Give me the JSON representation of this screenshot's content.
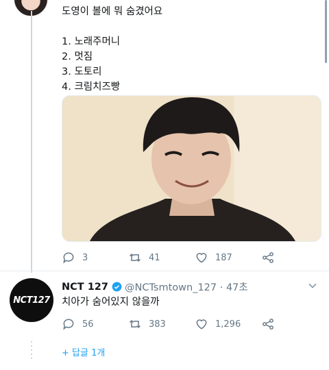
{
  "tweet1": {
    "text": "도영이 볼에 뭐 숨겼어요\n\n1. 노래주머니\n2. 멋짐\n3. 도토리\n4. 크림치즈빵",
    "stats": {
      "replies": "3",
      "retweets": "41",
      "likes": "187"
    }
  },
  "tweet2": {
    "name": "NCT 127",
    "handle": "@NCTsmtown_127 · 47초",
    "text": "치아가 숨어있지 않을까",
    "avatar_text": "NCT127",
    "stats": {
      "replies": "56",
      "retweets": "383",
      "likes": "1,296"
    },
    "show_replies": "+ 답글 1개"
  },
  "colors": {
    "accent": "#1da1f2",
    "muted": "#657786",
    "divider": "#e6ecf0"
  },
  "icons": [
    "reply-icon",
    "retweet-icon",
    "like-icon",
    "share-icon",
    "verified-icon",
    "chevron-down-icon"
  ]
}
